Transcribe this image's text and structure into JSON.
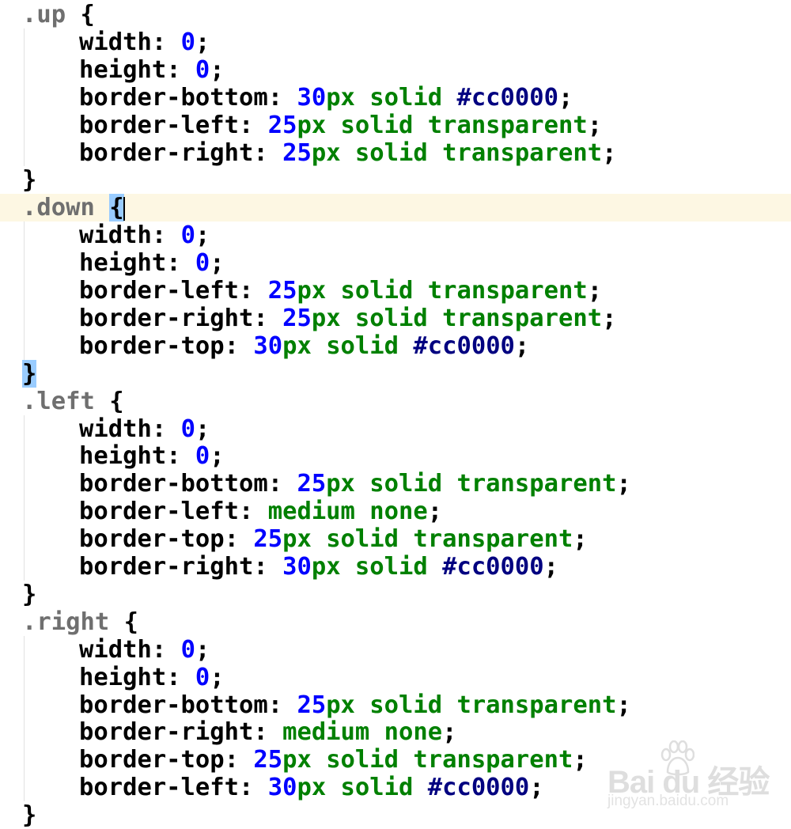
{
  "editor": {
    "language": "css",
    "rules": [
      {
        "selector": ".up",
        "declarations": [
          {
            "prop": "width",
            "value": [
              {
                "t": "num",
                "v": "0"
              }
            ]
          },
          {
            "prop": "height",
            "value": [
              {
                "t": "num",
                "v": "0"
              }
            ]
          },
          {
            "prop": "border-bottom",
            "value": [
              {
                "t": "num",
                "v": "30"
              },
              {
                "t": "kw",
                "v": "px solid "
              },
              {
                "t": "hex",
                "v": "#cc0000"
              }
            ]
          },
          {
            "prop": "border-left",
            "value": [
              {
                "t": "num",
                "v": "25"
              },
              {
                "t": "kw",
                "v": "px solid transparent"
              }
            ]
          },
          {
            "prop": "border-right",
            "value": [
              {
                "t": "num",
                "v": "25"
              },
              {
                "t": "kw",
                "v": "px solid transparent"
              }
            ]
          }
        ]
      },
      {
        "selector": ".down",
        "current": true,
        "declarations": [
          {
            "prop": "width",
            "value": [
              {
                "t": "num",
                "v": "0"
              }
            ]
          },
          {
            "prop": "height",
            "value": [
              {
                "t": "num",
                "v": "0"
              }
            ]
          },
          {
            "prop": "border-left",
            "value": [
              {
                "t": "num",
                "v": "25"
              },
              {
                "t": "kw",
                "v": "px solid transparent"
              }
            ]
          },
          {
            "prop": "border-right",
            "value": [
              {
                "t": "num",
                "v": "25"
              },
              {
                "t": "kw",
                "v": "px solid transparent"
              }
            ]
          },
          {
            "prop": "border-top",
            "value": [
              {
                "t": "num",
                "v": "30"
              },
              {
                "t": "kw",
                "v": "px solid "
              },
              {
                "t": "hex",
                "v": "#cc0000"
              }
            ]
          }
        ]
      },
      {
        "selector": ".left",
        "declarations": [
          {
            "prop": "width",
            "value": [
              {
                "t": "num",
                "v": "0"
              }
            ]
          },
          {
            "prop": "height",
            "value": [
              {
                "t": "num",
                "v": "0"
              }
            ]
          },
          {
            "prop": "border-bottom",
            "value": [
              {
                "t": "num",
                "v": "25"
              },
              {
                "t": "kw",
                "v": "px solid transparent"
              }
            ]
          },
          {
            "prop": "border-left",
            "value": [
              {
                "t": "kw",
                "v": "medium none"
              }
            ]
          },
          {
            "prop": "border-top",
            "value": [
              {
                "t": "num",
                "v": "25"
              },
              {
                "t": "kw",
                "v": "px solid transparent"
              }
            ]
          },
          {
            "prop": "border-right",
            "value": [
              {
                "t": "num",
                "v": "30"
              },
              {
                "t": "kw",
                "v": "px solid "
              },
              {
                "t": "hex",
                "v": "#cc0000"
              }
            ]
          }
        ]
      },
      {
        "selector": ".right",
        "declarations": [
          {
            "prop": "width",
            "value": [
              {
                "t": "num",
                "v": "0"
              }
            ]
          },
          {
            "prop": "height",
            "value": [
              {
                "t": "num",
                "v": "0"
              }
            ]
          },
          {
            "prop": "border-bottom",
            "value": [
              {
                "t": "num",
                "v": "25"
              },
              {
                "t": "kw",
                "v": "px solid transparent"
              }
            ]
          },
          {
            "prop": "border-right",
            "value": [
              {
                "t": "kw",
                "v": "medium none"
              }
            ]
          },
          {
            "prop": "border-top",
            "value": [
              {
                "t": "num",
                "v": "25"
              },
              {
                "t": "kw",
                "v": "px solid transparent"
              }
            ]
          },
          {
            "prop": "border-left",
            "value": [
              {
                "t": "num",
                "v": "30"
              },
              {
                "t": "kw",
                "v": "px solid "
              },
              {
                "t": "hex",
                "v": "#cc0000"
              }
            ]
          }
        ]
      }
    ],
    "colors": {
      "number": "#0000ff",
      "keyword": "#008000",
      "hex_value": "#000080",
      "selector": "#6f6f6f",
      "current_line_bg": "#fdf7e3",
      "brace_match_bg": "#99ccff"
    }
  },
  "watermark": {
    "logo_text": "Bai du 经验",
    "url": "jingyan.baidu.com",
    "icon": "baidu-paw-icon"
  }
}
